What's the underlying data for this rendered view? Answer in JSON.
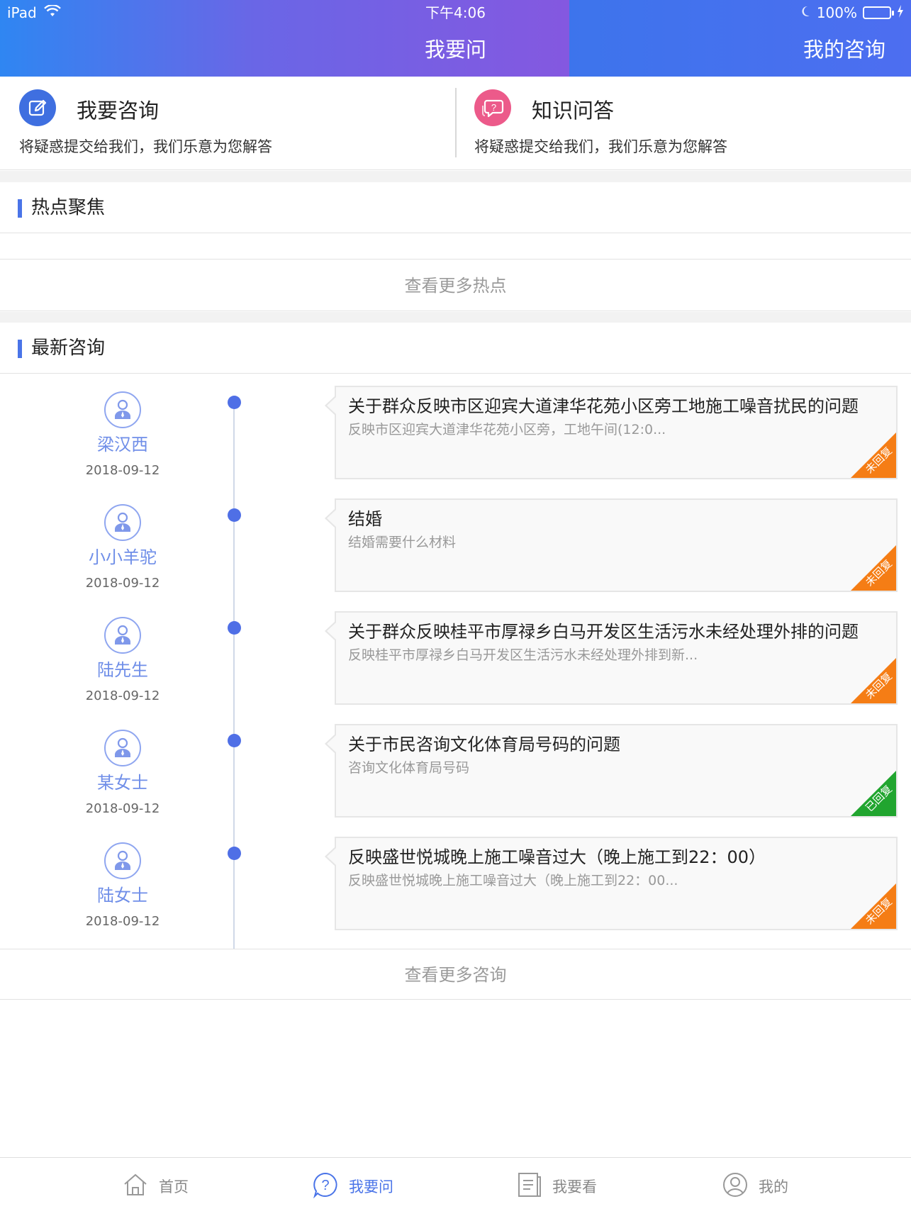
{
  "status_bar": {
    "device": "iPad",
    "time": "下午4:06",
    "battery": "100%"
  },
  "header": {
    "title": "我要问",
    "right_tab": "我的咨询"
  },
  "features": [
    {
      "icon": "edit-icon",
      "title": "我要咨询",
      "desc": "将疑惑提交给我们，我们乐意为您解答",
      "color": "#3f6fe0"
    },
    {
      "icon": "chat-question-icon",
      "title": "知识问答",
      "desc": "将疑惑提交给我们，我们乐意为您解答",
      "color": "#ec5a8a"
    }
  ],
  "hot": {
    "label": "热点聚焦",
    "more": "查看更多热点"
  },
  "latest": {
    "label": "最新咨询",
    "more": "查看更多咨询",
    "items": [
      {
        "name": "梁汉西",
        "date": "2018-09-12",
        "title": "关于群众反映市区迎宾大道津华花苑小区旁工地施工噪音扰民的问题",
        "desc": "反映市区迎宾大道津华花苑小区旁，工地午间(12:0...",
        "status": "未回复",
        "status_color": "orange"
      },
      {
        "name": "小小羊驼",
        "date": "2018-09-12",
        "title": "结婚",
        "desc": "结婚需要什么材料",
        "status": "未回复",
        "status_color": "orange"
      },
      {
        "name": "陆先生",
        "date": "2018-09-12",
        "title": "关于群众反映桂平市厚禄乡白马开发区生活污水未经处理外排的问题",
        "desc": "反映桂平市厚禄乡白马开发区生活污水未经处理外排到新...",
        "status": "未回复",
        "status_color": "orange"
      },
      {
        "name": "某女士",
        "date": "2018-09-12",
        "title": "关于市民咨询文化体育局号码的问题",
        "desc": "咨询文化体育局号码",
        "status": "已回复",
        "status_color": "green"
      },
      {
        "name": "陆女士",
        "date": "2018-09-12",
        "title": "反映盛世悦城晚上施工噪音过大（晚上施工到22：00）",
        "desc": "反映盛世悦城晚上施工噪音过大（晚上施工到22：00...",
        "status": "未回复",
        "status_color": "orange"
      }
    ]
  },
  "tabbar": [
    {
      "icon": "home-icon",
      "label": "首页",
      "active": false
    },
    {
      "icon": "question-icon",
      "label": "我要问",
      "active": true
    },
    {
      "icon": "document-icon",
      "label": "我要看",
      "active": false
    },
    {
      "icon": "user-icon",
      "label": "我的",
      "active": false
    }
  ],
  "colors": {
    "accent": "#4a74e8",
    "unreplied": "#f57d15",
    "replied": "#21a52f"
  }
}
